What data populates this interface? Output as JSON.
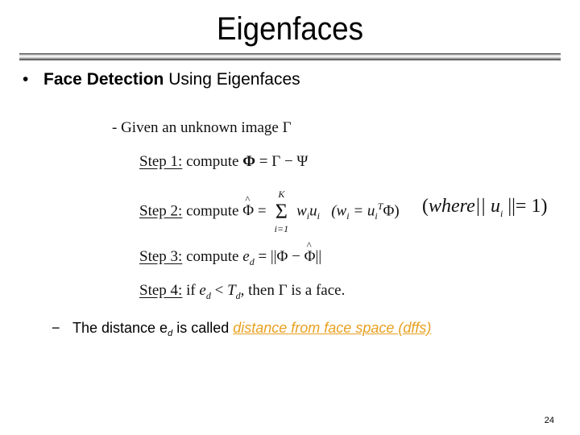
{
  "slide": {
    "title": "Eigenfaces",
    "bullet": {
      "symbol": "•",
      "bold_text": "Face Detection",
      "rest_text": " Using Eigenfaces"
    },
    "formulas": {
      "given": {
        "prefix": "- Given an unknown image ",
        "symbol": "Γ"
      },
      "step1": {
        "label": "Step 1:",
        "text": " compute ",
        "lhs": "Φ",
        "rhs": " = Γ − Ψ"
      },
      "step2": {
        "label": "Step 2:",
        "text": " compute ",
        "lhs": "Φ",
        "eq": " = ",
        "sum_symbol": "Σ",
        "sum_upper": "K",
        "sum_lower": "i=1",
        "term": "w",
        "term_sub": "i",
        "term2": "u",
        "term2_sub": "i",
        "paren": "(w",
        "paren_sub": "i",
        "paren_eq": " = u",
        "paren_sub2": "i",
        "paren_sup": "T",
        "paren_end": "Φ)"
      },
      "where_note": {
        "open": "(",
        "word": "where",
        "norm": "|| u",
        "norm_sub": "i",
        "close": " ||= 1)"
      },
      "step3": {
        "label": "Step 3:",
        "text": " compute ",
        "lhs": "e",
        "lhs_sub": "d",
        "rhs_a": " = ||Φ − ",
        "rhs_hat": "Φ",
        "rhs_b": "||"
      },
      "step4": {
        "label": "Step 4:",
        "text": " if ",
        "e": "e",
        "e_sub": "d",
        "lt": " < ",
        "t": "T",
        "t_sub": "d",
        "then": ", then ",
        "gamma": "Γ",
        "end": " is a face."
      }
    },
    "sub_bullet": {
      "dash": "−",
      "text_before": "The distance e",
      "subscript": "d",
      "text_middle": " is called ",
      "link_text": "distance from face space (dffs)"
    },
    "page_number": "24",
    "colors": {
      "link": "#e8a020"
    }
  }
}
